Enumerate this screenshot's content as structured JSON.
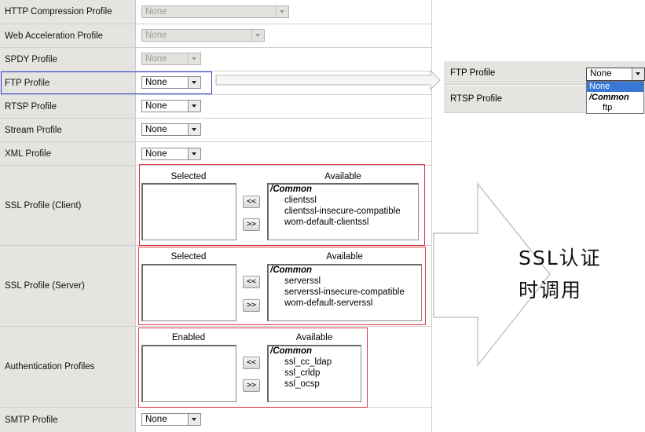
{
  "rows": {
    "http": {
      "label": "HTTP Compression Profile",
      "value": "None"
    },
    "webaccel": {
      "label": "Web Acceleration Profile",
      "value": "None"
    },
    "spdy": {
      "label": "SPDY Profile",
      "value": "None"
    },
    "ftp": {
      "label": "FTP Profile",
      "value": "None"
    },
    "rtsp": {
      "label": "RTSP Profile",
      "value": "None"
    },
    "stream": {
      "label": "Stream Profile",
      "value": "None"
    },
    "xml": {
      "label": "XML Profile",
      "value": "None"
    },
    "smtp": {
      "label": "SMTP Profile",
      "value": "None"
    }
  },
  "ssl_client": {
    "label": "SSL Profile (Client)",
    "selected_caption": "Selected",
    "available_caption": "Available",
    "group": "/Common",
    "items": [
      "clientssl",
      "clientssl-insecure-compatible",
      "wom-default-clientssl"
    ]
  },
  "ssl_server": {
    "label": "SSL Profile (Server)",
    "selected_caption": "Selected",
    "available_caption": "Available",
    "group": "/Common",
    "items": [
      "serverssl",
      "serverssl-insecure-compatible",
      "wom-default-serverssl"
    ]
  },
  "auth": {
    "label": "Authentication Profiles",
    "selected_caption": "Enabled",
    "available_caption": "Available",
    "group": "/Common",
    "items": [
      "ssl_cc_ldap",
      "ssl_crldp",
      "ssl_ocsp"
    ]
  },
  "buttons": {
    "add": "<<",
    "remove": ">>"
  },
  "zoom": {
    "ftp_label": "FTP Profile",
    "rtsp_label": "RTSP Profile",
    "select_value": "None",
    "options": {
      "none": "None",
      "group": "/Common",
      "ftp": "ftp"
    }
  },
  "annotation": {
    "line1": "SSL认证",
    "line2": "时调用"
  },
  "colors": {
    "highlight_box": "#d9383f",
    "ftp_box": "#2e3fd0",
    "dropdown_selected": "#3a78d6"
  }
}
